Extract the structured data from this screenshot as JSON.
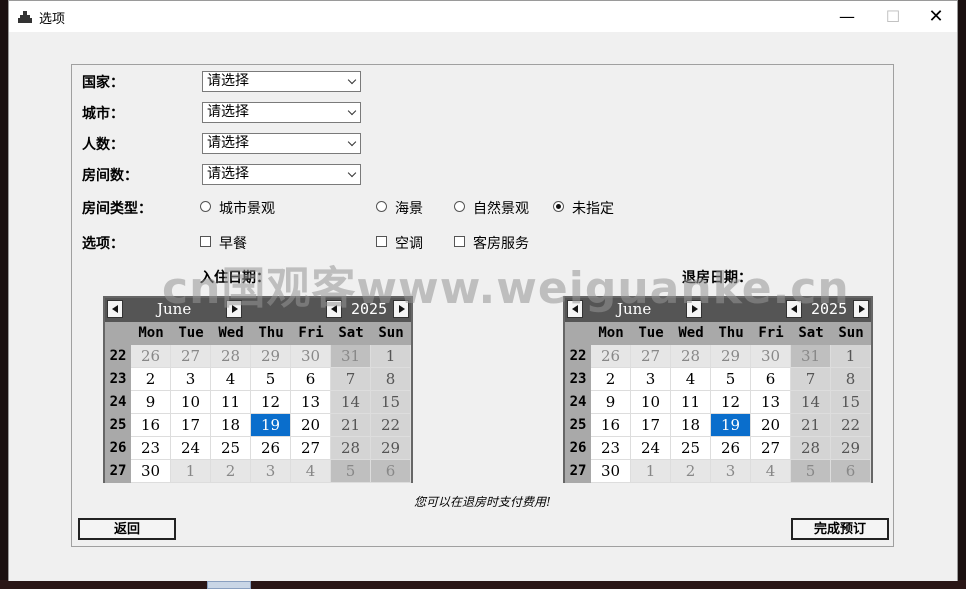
{
  "window": {
    "title": "选项",
    "minimize": "—",
    "maximize": "☐",
    "close": "✕"
  },
  "form": {
    "country": {
      "label": "国家：",
      "value": "请选择"
    },
    "city": {
      "label": "城市：",
      "value": "请选择"
    },
    "people": {
      "label": "人数：",
      "value": "请选择"
    },
    "rooms": {
      "label": "房间数：",
      "value": "请选择"
    },
    "room_type": {
      "label": "房间类型：",
      "options": [
        "城市景观",
        "海景",
        "自然景观",
        "未指定"
      ],
      "selected": "未指定"
    },
    "extras": {
      "label": "选项：",
      "options": [
        "早餐",
        "空调",
        "客房服务"
      ],
      "checked": []
    }
  },
  "watermark": "cn国观客www.weiguanke.cn",
  "checkin": {
    "label": "入住日期："
  },
  "checkout": {
    "label": "退房日期："
  },
  "calendar": {
    "month": "June",
    "year": "2025",
    "weekdays": [
      "Mon",
      "Tue",
      "Wed",
      "Thu",
      "Fri",
      "Sat",
      "Sun"
    ],
    "weeks": [
      {
        "week": "22",
        "days": [
          "26",
          "27",
          "28",
          "29",
          "30",
          "31",
          "1"
        ]
      },
      {
        "week": "23",
        "days": [
          "2",
          "3",
          "4",
          "5",
          "6",
          "7",
          "8"
        ]
      },
      {
        "week": "24",
        "days": [
          "9",
          "10",
          "11",
          "12",
          "13",
          "14",
          "15"
        ]
      },
      {
        "week": "25",
        "days": [
          "16",
          "17",
          "18",
          "19",
          "20",
          "21",
          "22"
        ]
      },
      {
        "week": "26",
        "days": [
          "23",
          "24",
          "25",
          "26",
          "27",
          "28",
          "29"
        ]
      },
      {
        "week": "27",
        "days": [
          "30",
          "1",
          "2",
          "3",
          "4",
          "5",
          "6"
        ]
      }
    ],
    "selected_day": "19"
  },
  "note": "您可以在退房时支付费用!",
  "buttons": {
    "back": "返回",
    "finish": "完成预订"
  },
  "colors": {
    "selected_day": "#0a6ecc",
    "calendar_header": "#555555"
  }
}
